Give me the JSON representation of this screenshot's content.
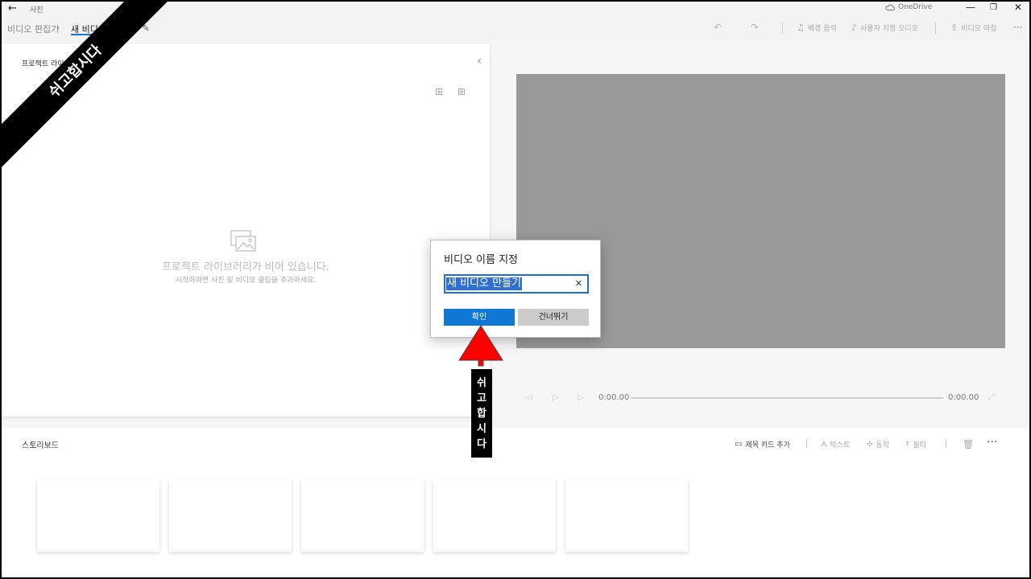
{
  "titlebar": {
    "app_name": "사진",
    "onedrive": "OneDrive"
  },
  "toolbar": {
    "breadcrumb_parent": "비디오 편집기",
    "breadcrumb_current": "새 비디오",
    "background_music": "배경 음악",
    "custom_audio": "사용자 지정 오디오",
    "finish_video": "비디오 마침"
  },
  "library": {
    "title": "프로젝트 라이브러리",
    "empty_title": "프로젝트 라이브러리가 비어 있습니다.",
    "empty_subtitle": "시작하려면 사진 및 비디오 클립을 추가하세요."
  },
  "player": {
    "current_time": "0:00.00",
    "total_time": "0:00.00"
  },
  "storyboard": {
    "title": "스토리보드",
    "add_title_card": "제목 카드 추가",
    "text": "텍스트",
    "motion": "동작",
    "filters": "필터"
  },
  "dialog": {
    "title": "비디오 이름 지정",
    "input_value": "새 비디오 만들기",
    "ok_label": "확인",
    "skip_label": "건너뛰기"
  },
  "annotation": {
    "banner": "쉬고합시다",
    "vertical": [
      "쉬",
      "고",
      "합",
      "시",
      "다"
    ],
    "arrow_color": "#ff0000"
  }
}
